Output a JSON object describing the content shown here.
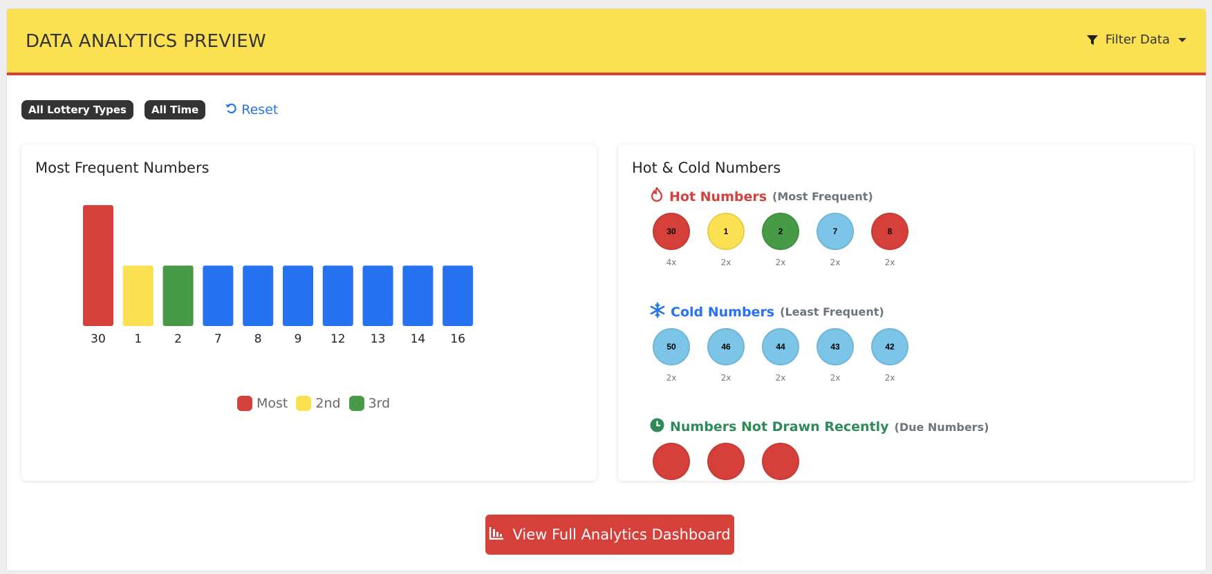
{
  "header": {
    "title": "DATA ANALYTICS PREVIEW",
    "filter_label": "Filter Data"
  },
  "filters": {
    "chip_type": "All Lottery Types",
    "chip_time": "All Time",
    "reset_label": "Reset"
  },
  "left_panel": {
    "title": "Most Frequent Numbers",
    "legend": [
      {
        "label": "Most",
        "color": "#d6403a"
      },
      {
        "label": "2nd",
        "color": "#fbe051"
      },
      {
        "label": "3rd",
        "color": "#479b47"
      }
    ]
  },
  "chart_data": {
    "type": "bar",
    "categories": [
      "30",
      "1",
      "2",
      "7",
      "8",
      "9",
      "12",
      "13",
      "14",
      "16"
    ],
    "values": [
      4,
      2,
      2,
      2,
      2,
      2,
      2,
      2,
      2,
      2
    ],
    "colors": [
      "#d6403a",
      "#fbe051",
      "#479b47",
      "#2672f0",
      "#2672f0",
      "#2672f0",
      "#2672f0",
      "#2672f0",
      "#2672f0",
      "#2672f0"
    ],
    "ylim": [
      0,
      4
    ],
    "grid": false,
    "legend_position": "bottom"
  },
  "right_panel": {
    "title": "Hot & Cold Numbers",
    "hot": {
      "title": "Hot Numbers",
      "subtitle": "(Most Frequent)",
      "color": "#d6403a",
      "balls": [
        {
          "number": "30",
          "count": "4x",
          "color": "#d6403a"
        },
        {
          "number": "1",
          "count": "2x",
          "color": "#fbe051"
        },
        {
          "number": "2",
          "count": "2x",
          "color": "#479b47"
        },
        {
          "number": "7",
          "count": "2x",
          "color": "#7cc4e8"
        },
        {
          "number": "8",
          "count": "2x",
          "color": "#d6403a"
        }
      ]
    },
    "cold": {
      "title": "Cold Numbers",
      "subtitle": "(Least Frequent)",
      "color": "#2672f0",
      "balls": [
        {
          "number": "50",
          "count": "2x",
          "color": "#7cc4e8"
        },
        {
          "number": "46",
          "count": "2x",
          "color": "#7cc4e8"
        },
        {
          "number": "44",
          "count": "2x",
          "color": "#7cc4e8"
        },
        {
          "number": "43",
          "count": "2x",
          "color": "#7cc4e8"
        },
        {
          "number": "42",
          "count": "2x",
          "color": "#7cc4e8"
        }
      ]
    },
    "due": {
      "title": "Numbers Not Drawn Recently",
      "subtitle": "(Due Numbers)",
      "color": "#2e8b57"
    }
  },
  "cta": {
    "label": "View Full Analytics Dashboard"
  },
  "icons": {
    "filter": "filter-icon",
    "reset": "undo-icon",
    "hot": "fire-icon",
    "cold": "snowflake-icon",
    "due": "clock-icon",
    "cta": "chart-icon"
  }
}
